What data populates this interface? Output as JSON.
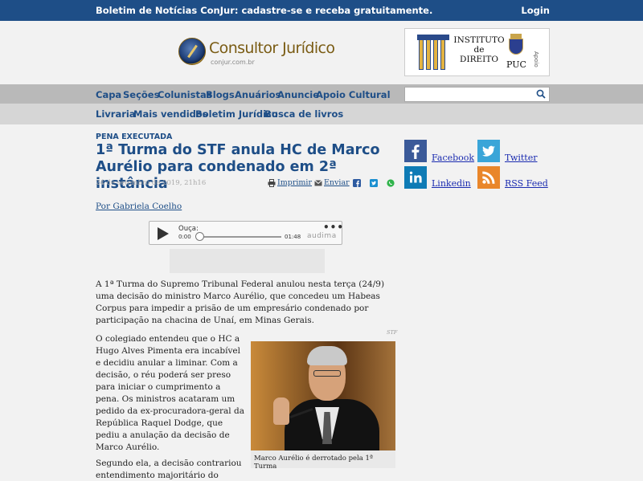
{
  "topbar": {
    "newsletter": "Boletim de Notícias ConJur: cadastre-se e receba gratuitamente.",
    "login": "Login"
  },
  "logo": {
    "name": "Consultor Jurídico",
    "url_text": "conjur.com.br"
  },
  "sponsor": {
    "line1": "INSTITUTO",
    "line2": "de",
    "line3": "DIREITO",
    "puc": "PUC",
    "apoio": "Apoio"
  },
  "nav_primary": [
    "Capa",
    "Seções",
    "Colunistas",
    "Blogs",
    "Anuários",
    "Anuncie",
    "Apoio Cultural"
  ],
  "nav_secondary": [
    "Livraria",
    "Mais vendidos",
    "Boletim Jurídico",
    "Busca de livros"
  ],
  "search": {
    "placeholder": "",
    "value": ""
  },
  "article": {
    "kicker": "PENA EXECUTADA",
    "headline": "1ª Turma do STF anula HC de Marco Aurélio para condenado em 2ª instância",
    "date": "24 de setembro de 2019, 21h16",
    "tools": {
      "print": "Imprimir",
      "send": "Enviar"
    },
    "author": "Por Gabriela Coelho",
    "player": {
      "label": "Ouça:",
      "time_start": "0:00",
      "time_end": "01:48",
      "brand": "audima",
      "progress": 0
    },
    "p1": "A 1ª Turma do Supremo Tribunal Federal anulou nesta terça (24/9) uma decisão do ministro Marco Aurélio, que concedeu um Habeas Corpus para impedir a prisão de um empresário condenado por participação na chacina de Unaí, em Minas Gerais.",
    "p2": "O colegiado entendeu que o HC a Hugo Alves Pimenta era incabível e decidiu anular a liminar. Com a decisão, o réu poderá ser preso para iniciar o cumprimento a pena. Os ministros acataram um pedido da ex-procuradora-geral da República Raquel Dodge, que pediu a anulação da decisão de Marco Aurélio.",
    "p3": "Segundo ela, a decisão contrariou entendimento majoritário do",
    "photo_credit": "STF",
    "photo_caption": "Marco Aurélio é derrotado pela 1ª Turma"
  },
  "social": [
    {
      "label": "Facebook",
      "icon": "facebook-icon",
      "color": "#3b5a99"
    },
    {
      "label": "Twitter",
      "icon": "twitter-icon",
      "color": "#3aa5d8"
    },
    {
      "label": "Linkedin",
      "icon": "linkedin-icon",
      "color": "#0e7bb5"
    },
    {
      "label": "RSS Feed",
      "icon": "rss-icon",
      "color": "#e9862a"
    }
  ],
  "colors": {
    "brand_blue": "#1e4e87",
    "nav_gray": "#b9b9b9",
    "link_blue": "#1a2bb0"
  }
}
